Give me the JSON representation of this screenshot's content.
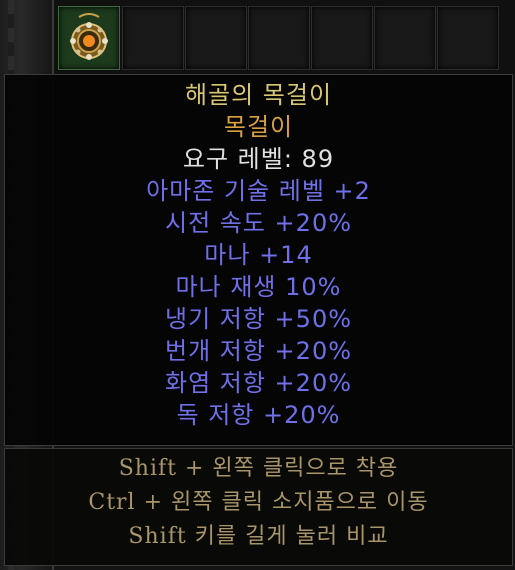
{
  "item": {
    "name": "해골의 목걸이",
    "base_type": "목걸이",
    "required_level": "요구 레벨: 89",
    "properties": [
      "아마존 기술 레벨 +2",
      "시전 속도 +20%",
      "마나 +14",
      "마나 재생 10%",
      "냉기 저항 +50%",
      "번개 저항 +20%",
      "화염 저항 +20%",
      "독 저항 +20%"
    ],
    "icon": "amulet-icon"
  },
  "help": {
    "lines": [
      "Shift + 왼쪽 클릭으로 착용",
      "Ctrl + 왼쪽 클릭 소지품으로 이동",
      "Shift 키를 길게 눌러 비교"
    ]
  },
  "colors": {
    "unique_name": "#d8c770",
    "base_type": "#d8a043",
    "requirement": "#e0e0e0",
    "magic_affix": "#6f6fe8",
    "help_text": "#a9956a"
  }
}
